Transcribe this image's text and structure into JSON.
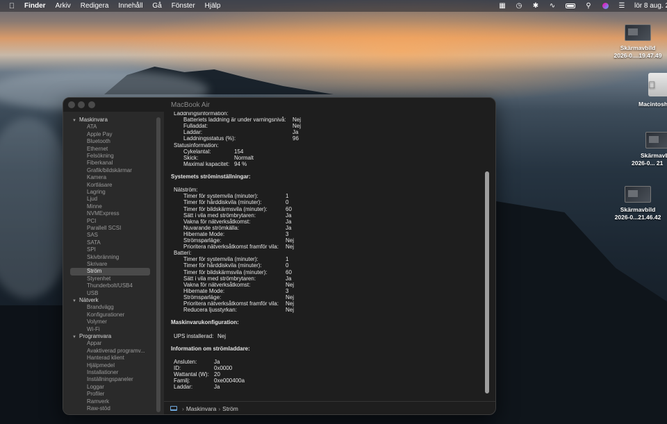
{
  "menubar": {
    "apple_icon": "",
    "items": [
      "Finder",
      "Arkiv",
      "Redigera",
      "Innehåll",
      "Gå",
      "Fönster",
      "Hjälp"
    ],
    "status_icons": [
      "grid-icon",
      "clock-icon",
      "bluetooth-icon",
      "wifi-icon",
      "battery-icon",
      "search-icon",
      "siri-icon",
      "control-center-icon"
    ],
    "clock": "lör 8 aug. 2"
  },
  "desktop": {
    "icons": [
      {
        "label_1": "Skärmavbild",
        "label_2": "2026-0....19.47.49"
      },
      {
        "label_1": "Macintosh",
        "label_2": ""
      },
      {
        "label_1": "Skärmavb",
        "label_2": "2026-0... 21"
      },
      {
        "label_1": "Skärmavbild",
        "label_2": "2026-0...21.46.42"
      }
    ]
  },
  "window": {
    "title": "MacBook Air",
    "sidebar": [
      {
        "label": "Maskinvara",
        "group": true
      },
      {
        "label": "ATA"
      },
      {
        "label": "Apple Pay"
      },
      {
        "label": "Bluetooth"
      },
      {
        "label": "Ethernet"
      },
      {
        "label": "Felsökning"
      },
      {
        "label": "Fiberkanal"
      },
      {
        "label": "Grafik/bildskärmar"
      },
      {
        "label": "Kamera"
      },
      {
        "label": "Kortläsare"
      },
      {
        "label": "Lagring"
      },
      {
        "label": "Ljud"
      },
      {
        "label": "Minne"
      },
      {
        "label": "NVMExpress"
      },
      {
        "label": "PCI"
      },
      {
        "label": "Parallell SCSI"
      },
      {
        "label": "SAS"
      },
      {
        "label": "SATA"
      },
      {
        "label": "SPI"
      },
      {
        "label": "Skivbränning"
      },
      {
        "label": "Skrivare"
      },
      {
        "label": "Ström",
        "selected": true
      },
      {
        "label": "Styrenhet"
      },
      {
        "label": "Thunderbolt/USB4"
      },
      {
        "label": "USB"
      },
      {
        "label": "Nätverk",
        "group": true
      },
      {
        "label": "Brandvägg"
      },
      {
        "label": "Konfigurationer"
      },
      {
        "label": "Volymer"
      },
      {
        "label": "Wi-Fi"
      },
      {
        "label": "Programvara",
        "group": true
      },
      {
        "label": "Appar"
      },
      {
        "label": "Avaktiverad programv..."
      },
      {
        "label": "Hanterad klient"
      },
      {
        "label": "Hjälpmedel"
      },
      {
        "label": "Installationer"
      },
      {
        "label": "Inställningspaneler"
      },
      {
        "label": "Loggar"
      },
      {
        "label": "Profiler"
      },
      {
        "label": "Ramverk"
      },
      {
        "label": "Raw-stöd"
      }
    ],
    "content": [
      {
        "k": "Laddningsinformation:",
        "v": "",
        "lvl": 1
      },
      {
        "k": "Batteriets laddning är under varningsnivå:",
        "v": "Nej",
        "lvl": 2,
        "vx": 1
      },
      {
        "k": "Fulladdat:",
        "v": "Nej",
        "lvl": 2,
        "vx": 1
      },
      {
        "k": "Laddar:",
        "v": "Ja",
        "lvl": 2,
        "vx": 1
      },
      {
        "k": "Laddningsstatus (%):",
        "v": "96",
        "lvl": 2,
        "vx": 1
      },
      {
        "k": "Statusinformation:",
        "v": "",
        "lvl": 1
      },
      {
        "k": "Cykelantal:",
        "v": "154",
        "lvl": 2,
        "vx": 2
      },
      {
        "k": "Skick:",
        "v": "Normalt",
        "lvl": 2,
        "vx": 2
      },
      {
        "k": "Maximal kapacitet:",
        "v": "94 %",
        "lvl": 2,
        "vx": 2
      },
      {
        "gap": 1
      },
      {
        "k": "Systemets strömінställningar:",
        "v": "",
        "lvl": 0,
        "h": true
      },
      {
        "gap": 1
      },
      {
        "k": "Nätström:",
        "v": "",
        "lvl": 1
      },
      {
        "k": "Timer för systemvila (minuter):",
        "v": "1",
        "lvl": 2,
        "vx": 3
      },
      {
        "k": "Timer för hårddiskvila (minuter):",
        "v": "0",
        "lvl": 2,
        "vx": 3
      },
      {
        "k": "Timer för bildskärmsvila (minuter):",
        "v": "60",
        "lvl": 2,
        "vx": 3
      },
      {
        "k": "Sätt i vila med strömbrytaren:",
        "v": "Ja",
        "lvl": 2,
        "vx": 3
      },
      {
        "k": "Vakna för nätverksåtkomst:",
        "v": "Ja",
        "lvl": 2,
        "vx": 3
      },
      {
        "k": "Nuvarande strömkälla:",
        "v": "Ja",
        "lvl": 2,
        "vx": 3
      },
      {
        "k": "Hibernate Mode:",
        "v": "3",
        "lvl": 2,
        "vx": 3
      },
      {
        "k": "Strömsparläge:",
        "v": "Nej",
        "lvl": 2,
        "vx": 3
      },
      {
        "k": "Prioritera nätverksåtkomst framför vila:",
        "v": "Nej",
        "lvl": 2,
        "vx": 3
      },
      {
        "k": "Batteri:",
        "v": "",
        "lvl": 1
      },
      {
        "k": "Timer för systemvila (minuter):",
        "v": "1",
        "lvl": 2,
        "vx": 3
      },
      {
        "k": "Timer för hårddiskvila (minuter):",
        "v": "0",
        "lvl": 2,
        "vx": 3
      },
      {
        "k": "Timer för bildskärmsvila (minuter):",
        "v": "60",
        "lvl": 2,
        "vx": 3
      },
      {
        "k": "Sätt i vila med strömbrytaren:",
        "v": "Ja",
        "lvl": 2,
        "vx": 3
      },
      {
        "k": "Vakna för nätverksåtkomst:",
        "v": "Nej",
        "lvl": 2,
        "vx": 3
      },
      {
        "k": "Hibernate Mode:",
        "v": "3",
        "lvl": 2,
        "vx": 3
      },
      {
        "k": "Strömsparläge:",
        "v": "Nej",
        "lvl": 2,
        "vx": 3
      },
      {
        "k": "Prioritera nätverksåtkomst framför vila:",
        "v": "Nej",
        "lvl": 2,
        "vx": 3
      },
      {
        "k": "Reducera ljusstyrkan:",
        "v": "Nej",
        "lvl": 2,
        "vx": 3
      },
      {
        "gap": 1
      },
      {
        "k": "Maskinvarukonfiguration:",
        "v": "",
        "lvl": 0,
        "h": true
      },
      {
        "gap": 1
      },
      {
        "k": "UPS installerad:",
        "v": "Nej",
        "lvl": 1,
        "vx": 4
      },
      {
        "gap": 1
      },
      {
        "k": "Information om strömladdare:",
        "v": "",
        "lvl": 0,
        "h": true
      },
      {
        "gap": 1
      },
      {
        "k": "Ansluten:",
        "v": "Ja",
        "lvl": 1,
        "vx": 5
      },
      {
        "k": "ID:",
        "v": "0x0000",
        "lvl": 1,
        "vx": 5
      },
      {
        "k": "Wattantal (W):",
        "v": "20",
        "lvl": 1,
        "vx": 5
      },
      {
        "k": "Familj:",
        "v": "0xe000400a",
        "lvl": 1,
        "vx": 5
      },
      {
        "k": "Laddar:",
        "v": "Ja",
        "lvl": 1,
        "vx": 5
      }
    ],
    "pathbar": {
      "segments": [
        "Maskinvara",
        "Ström"
      ]
    }
  }
}
